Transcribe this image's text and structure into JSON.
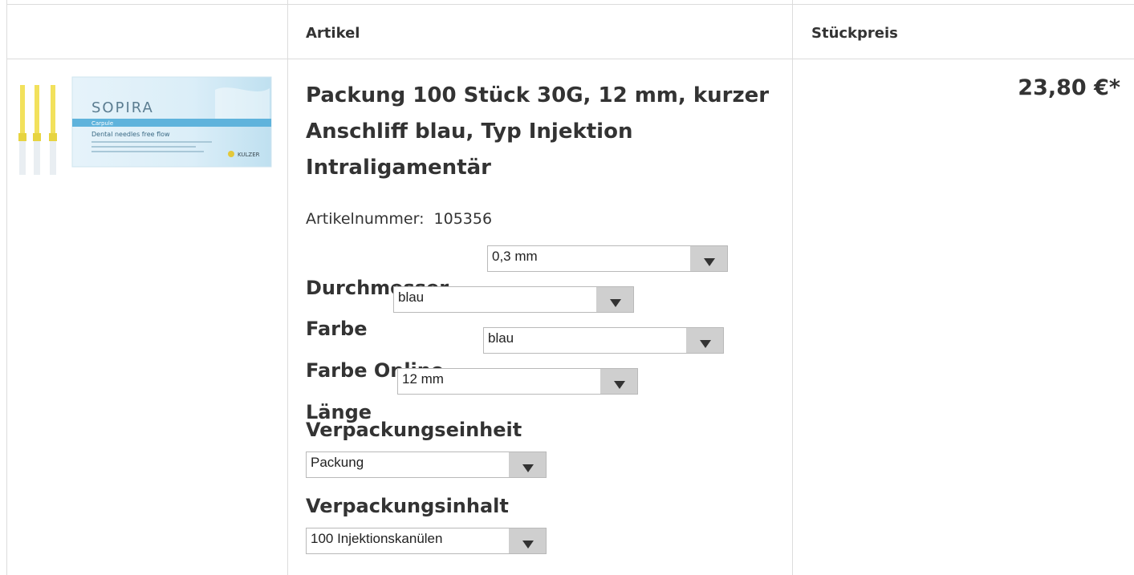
{
  "table": {
    "header": {
      "col_article": "Artikel",
      "col_price": "Stückpreis"
    }
  },
  "product": {
    "title": "Packung 100 Stück 30G, 12 mm, kurzer Anschliff blau, Typ Injektion Intraligamentär",
    "article_number_label": "Artikelnummer:",
    "article_number": "105356",
    "price": "23,80 €*",
    "image": {
      "brand": "SOPIRA",
      "product_line": "Carpule",
      "tagline": "Dental needles free flow",
      "manufacturer": "KULZER"
    },
    "properties": {
      "durchmesser": {
        "label": "Durchmesser",
        "value": "0,3 mm"
      },
      "farbe": {
        "label": "Farbe",
        "value": "blau"
      },
      "farbe_online": {
        "label": "Farbe Online",
        "value": "blau"
      },
      "laenge": {
        "label": "Länge",
        "value": "12 mm"
      },
      "verpackungseinheit": {
        "label": "Verpackungseinheit",
        "value": "Packung"
      },
      "verpackungsinhalt": {
        "label": "Verpackungsinhalt",
        "value": "100 Injektionskanülen"
      }
    }
  }
}
